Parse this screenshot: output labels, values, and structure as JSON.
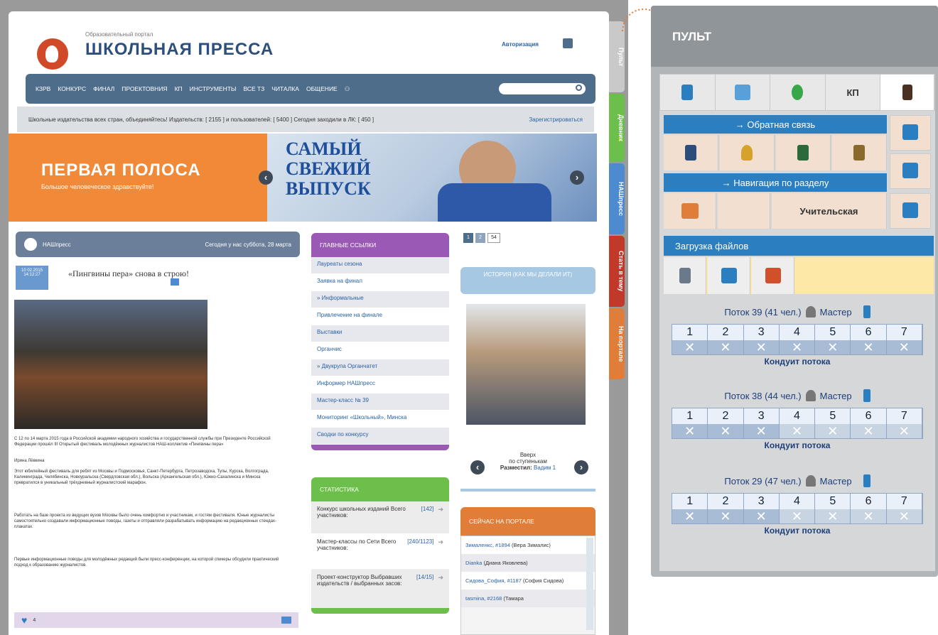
{
  "site": {
    "subtitle": "Образовательный портал",
    "title": "ШКОЛЬНАЯ ПРЕССА",
    "auth": "Авторизация"
  },
  "nav": [
    "КЗРВ",
    "КОНКУРС",
    "ФИНАЛ",
    "ПРОЕКТОВНИЯ",
    "КП",
    "ИНСТРУМЕНТЫ",
    "ВСЕ ТЗ",
    "ЧИТАЛКА",
    "ОБЩЕНИЕ"
  ],
  "subbar": {
    "text": "Школьные издательства всех стран, объединяйтесь! Издательств: [ 2155 ] и пользователей: [ 5400 ] Сегодня заходили в ЛК: [ 450 ]",
    "register": "Зарегистрироваться"
  },
  "banner": {
    "title": "ПЕРВАЯ ПОЛОСА",
    "subtitle": "Большое человеческое здравствуйте!",
    "promo": "САМЫЙ СВЕЖИЙ ВЫПУСК",
    "prev": "‹",
    "next": "›"
  },
  "news": {
    "header_left": "НАШпресс",
    "header_right": "Сегодня у нас суббота, 28 марта",
    "headline": "«Пингвины пера» снова в строю!",
    "date_badge": "10 02.2015 14:12:27",
    "caption": "С 12 по 14 марта 2015 года в Российской академии народного хозяйства и государственной службы при Президенте Российской Федерации прошёл III Открытый фестиваль молодёжных журналистов НАШ-коллектив «Пингвины пера»",
    "author": "Ирина Лёвкина",
    "body1": "Этот юбилейный фестиваль для ребят из Москвы и Подмосковья, Санкт-Петербурга, Петрозаводска, Тулы, Курска, Волгограда, Калининграда, Челябинска, Новоуральска (Свердловская обл.), Вольска (Архангельская обл.), Южно-Сахалинска и Минска превратился в уникальный трёхдневный журналистский марафон.",
    "body2": "Работать на базе проекта из ведущих вузов Москвы было очень комфортно и участникам, и гостям фестиваля. Юные журналисты самостоятельно создавали информационные поводы, газеты и отправляли разрабатывать информацию на редакционных стендах-плакатах.",
    "body3": "Первые информационные поводы для молодёжных редакций были пресс-конференции, на которой спикеры обсудили практический подход к образованию журналистов.",
    "likes": "4"
  },
  "links": {
    "header": "ГЛАВНЫЕ ССЫЛКИ",
    "items": [
      "Лауреаты сезона",
      "Заявка на финал",
      "» Информальные",
      "Привлечение на финале",
      "Выставки",
      "Органчис",
      "» Двукрупа Органчатет",
      "Информер НАШпресс",
      "Мастер-класс № 39",
      "Мониторинг «Школьный», Минска",
      "Сводки по конкурсу"
    ]
  },
  "stats": {
    "header": "СТАТИСТИКА",
    "items": [
      {
        "text": "Конкурс школьных изданий Всего участников:",
        "num": "[142]"
      },
      {
        "text": "Мастер-классы по Сети Всего участников:",
        "num": "[240/1123]"
      },
      {
        "text": "Проект-конструктор Выбравших издательств / выбранных засов:",
        "num": "[14/15]"
      }
    ]
  },
  "pager": {
    "a": "1",
    "b": "2",
    "c": "54"
  },
  "history": {
    "header": "ИСТОРИЯ (КАК МЫ ДЕЛАЛИ ИТ)",
    "caption1": "Вверх",
    "caption2": "по ступенькам",
    "placed": "Разместил:",
    "placed_by": "Вадим 1"
  },
  "online": {
    "header": "СЕЙЧАС НА ПОРТАЛЕ",
    "items": [
      {
        "nick": "Зималенкс, #1894",
        "name": "(Вера Зималис)"
      },
      {
        "nick": "Dianka",
        "name": "(Диана Яковлева)"
      },
      {
        "nick": "Сидова_София, #1187",
        "name": "(София Сидова)"
      },
      {
        "nick": "tasmina, #2168",
        "name": "(Тамара"
      }
    ]
  },
  "side_tabs": [
    "Пульт",
    "Дневник",
    "НАШпресс",
    "Стать в тему",
    "На портале"
  ],
  "pult": {
    "title": "ПУЛЬТ",
    "tab_kp": "КП",
    "feedback": "→ Обратная связь",
    "section_nav": "→ Навигация по разделу",
    "teacher": "Учительская",
    "uploads": "Загрузка файлов",
    "streams": [
      {
        "label": "Поток 39 (41 чел.)",
        "master": "Мастер",
        "cols": [
          "1",
          "2",
          "3",
          "4",
          "5",
          "6",
          "7"
        ],
        "footer": "Кондуит потока"
      },
      {
        "label": "Поток 38 (44 чел.)",
        "master": "Мастер",
        "cols": [
          "1",
          "2",
          "3",
          "4",
          "5",
          "6",
          "7"
        ],
        "footer": "Кондуит потока"
      },
      {
        "label": "Поток 29 (47 чел.)",
        "master": "Мастер",
        "cols": [
          "1",
          "2",
          "3",
          "4",
          "5",
          "6",
          "7"
        ],
        "footer": "Кондуит потока"
      }
    ],
    "x": "✕"
  },
  "colors": {
    "nav": "#4d6d8b",
    "orange": "#f08a38",
    "purple": "#9b59b6",
    "green": "#6cbf4a",
    "lightblue": "#a6c8e3",
    "panel": "#b2b5b8",
    "accent": "#2b7fc0"
  }
}
